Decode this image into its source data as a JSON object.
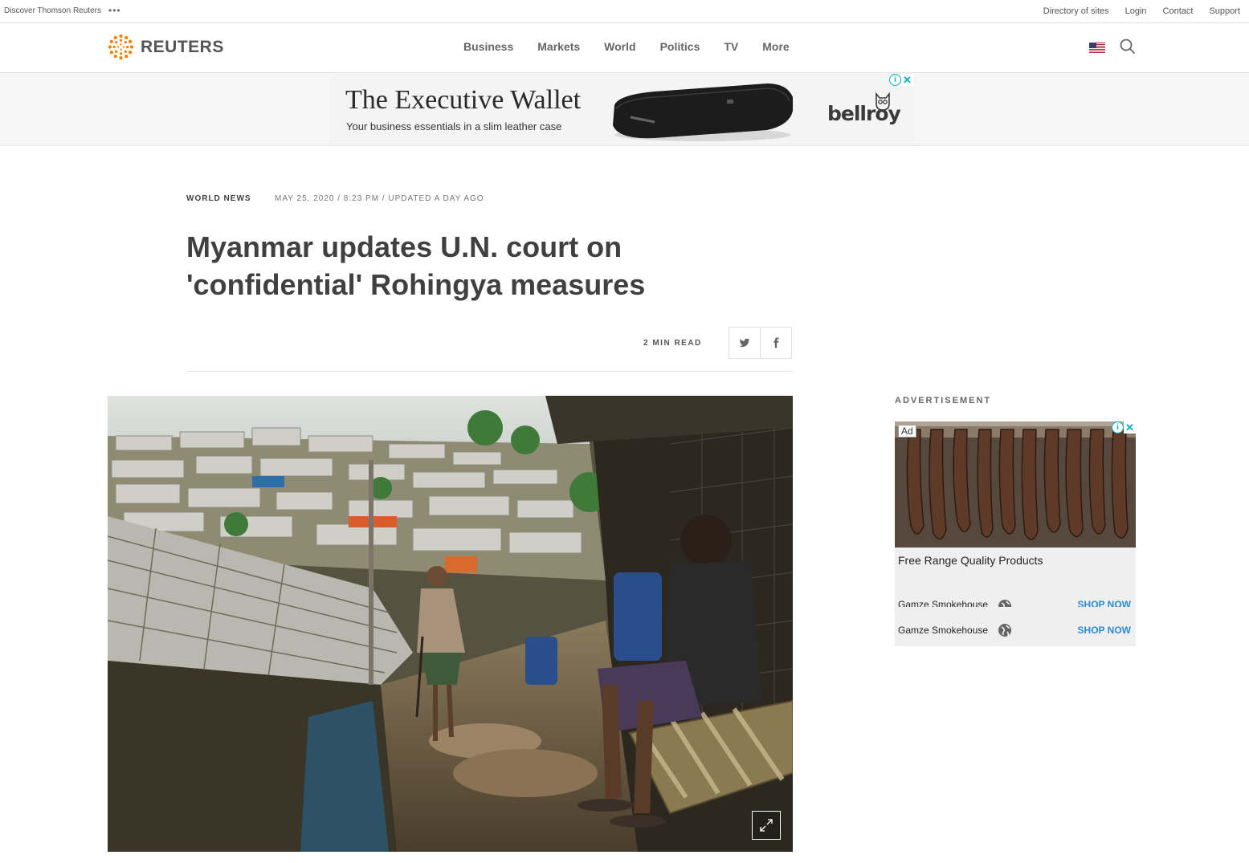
{
  "utility_bar": {
    "discover": "Discover Thomson Reuters",
    "dots": "•••",
    "links": [
      "Directory of sites",
      "Login",
      "Contact",
      "Support"
    ]
  },
  "header": {
    "logo_text": "REUTERS",
    "nav": [
      "Business",
      "Markets",
      "World",
      "Politics",
      "TV",
      "More"
    ],
    "accent_color": "#ff8000"
  },
  "banner_ad": {
    "headline": "The Executive Wallet",
    "tagline": "Your business essentials in a slim leather case",
    "brand": "bellroy"
  },
  "article": {
    "section": "WORLD NEWS",
    "dateline": "MAY 25, 2020 / 8:23 PM / UPDATED A DAY AGO",
    "title_line1": "Myanmar updates U.N. court on",
    "title_line2": "'confidential' Rohingya measures",
    "read_time": "2 MIN READ"
  },
  "sidebar": {
    "ad_label": "ADVERTISEMENT",
    "ad_tag": "Ad",
    "product": "Free Range Quality Products",
    "advertiser": "Gamze Smokehouse",
    "cta": "SHOP NOW"
  }
}
